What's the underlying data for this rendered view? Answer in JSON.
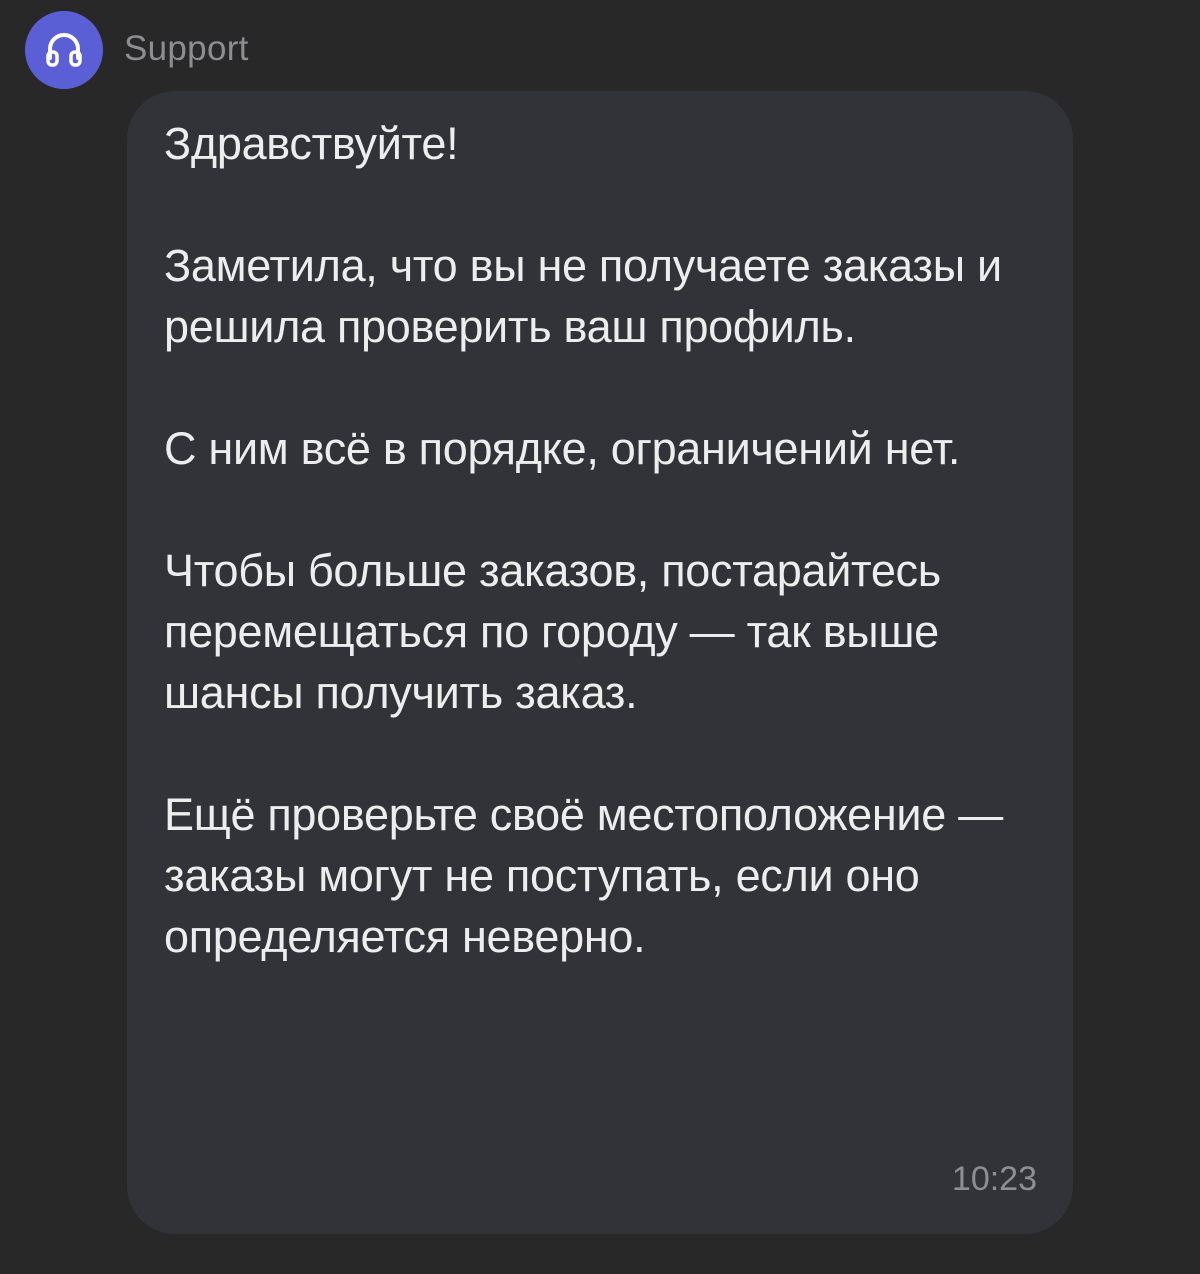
{
  "chat": {
    "sender": {
      "name": "Support",
      "avatar_icon": "headset-icon",
      "avatar_color": "#5a5fd6"
    },
    "message": {
      "text": "Здравствуйте!\n\nЗаметила, что вы не получаете заказы и решила проверить ваш профиль.\n\nС ним всё в порядке, ограничений нет.\n\nЧтобы больше заказов, постарайтесь перемещаться по городу — так выше шансы получить заказ.\n\nЕщё проверьте своё местоположение — заказы могут не поступать, если оно определяется неверно.",
      "time": "10:23"
    }
  },
  "colors": {
    "background": "#282828",
    "bubble": "#323239",
    "text": "#ededed",
    "muted": "#8e8e93"
  }
}
